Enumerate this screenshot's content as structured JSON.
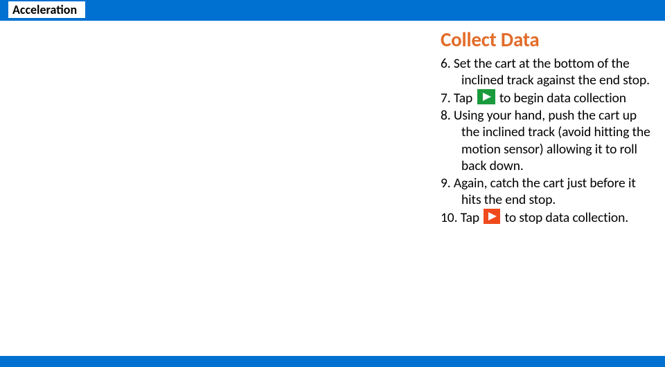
{
  "header": {
    "title": "Acceleration"
  },
  "section": {
    "title": "Collect Data"
  },
  "steps": {
    "s6": {
      "num": "6.",
      "text": "Set the cart at the bottom of the inclined track against the end stop."
    },
    "s7": {
      "num": "7.",
      "before": "Tap",
      "after": "to begin data collection"
    },
    "s8": {
      "num": "8.",
      "text": "Using your hand, push the cart up the inclined track (avoid hitting the motion sensor) allowing it to roll back down."
    },
    "s9": {
      "num": "9.",
      "text": "Again, catch the cart just before it hits the end stop."
    },
    "s10": {
      "num": "10.",
      "before": "Tap",
      "after": " to stop data collection."
    }
  },
  "icons": {
    "play": {
      "bg": "#1a9b3b"
    },
    "stop": {
      "bg": "#f04a1c"
    }
  }
}
